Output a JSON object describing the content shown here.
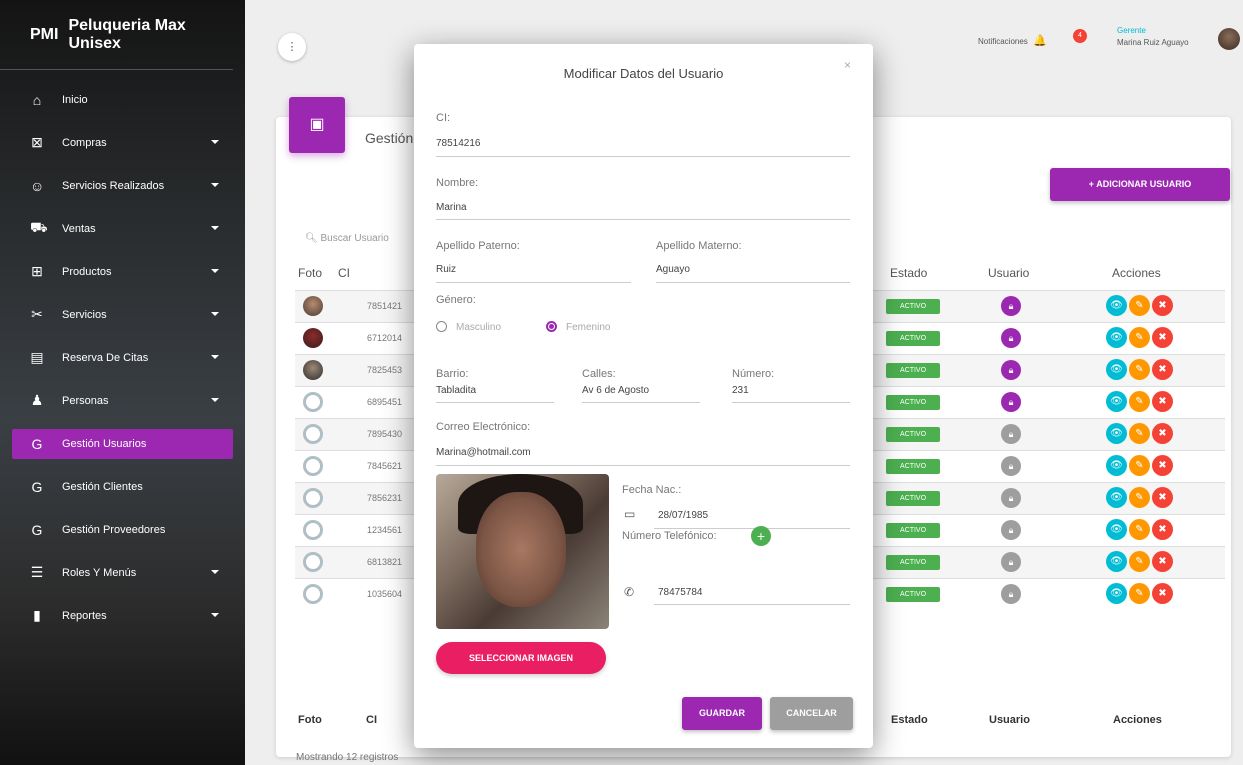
{
  "sidebar": {
    "brand_abbr": "PMI",
    "brand_name": "Peluqueria Max Unisex",
    "items": [
      {
        "label": "Inicio",
        "icon": "home-icon",
        "glyph": "⌂",
        "caret": false
      },
      {
        "label": "Compras",
        "icon": "cart-off-icon",
        "glyph": "⊠",
        "caret": true
      },
      {
        "label": "Servicios Realizados",
        "icon": "face-icon",
        "glyph": "☺",
        "caret": true
      },
      {
        "label": "Ventas",
        "icon": "cart-icon",
        "glyph": "⛟",
        "caret": true
      },
      {
        "label": "Productos",
        "icon": "basket-icon",
        "glyph": "⊞",
        "caret": true
      },
      {
        "label": "Servicios",
        "icon": "scissors-icon",
        "glyph": "✂",
        "caret": true
      },
      {
        "label": "Reserva De Citas",
        "icon": "list-icon",
        "glyph": "▤",
        "caret": true
      },
      {
        "label": "Personas",
        "icon": "person-icon",
        "glyph": "♟",
        "caret": true
      },
      {
        "label": "Gestión Usuarios",
        "icon": "letter-g-icon",
        "glyph": "G",
        "caret": false,
        "active": true
      },
      {
        "label": "Gestión Clientes",
        "icon": "letter-g-icon",
        "glyph": "G",
        "caret": false
      },
      {
        "label": "Gestión Proveedores",
        "icon": "letter-g-icon",
        "glyph": "G",
        "caret": false
      },
      {
        "label": "Roles Y Menús",
        "icon": "menu-icon",
        "glyph": "☰",
        "caret": true
      },
      {
        "label": "Reportes",
        "icon": "report-icon",
        "glyph": "▮",
        "caret": true
      }
    ]
  },
  "topbar": {
    "menu_dots": "⋮",
    "notifications_label": "Notificaciones",
    "notifications_count": "4",
    "user_role": "Gerente",
    "user_name": "Marina Ruiz Aguayo"
  },
  "card": {
    "title": "Gestión de Usuarios",
    "add_button": "+ ADICIONAR USUARIO",
    "search_placeholder": "Buscar Usuario",
    "headers": {
      "foto": "Foto",
      "ci": "CI",
      "estado": "Estado",
      "usuario": "Usuario",
      "acciones": "Acciones"
    },
    "rows": [
      {
        "ci": "7851421",
        "estado": "ACTIVO",
        "user_active": true,
        "photo": "photo"
      },
      {
        "ci": "6712014",
        "estado": "ACTIVO",
        "user_active": true,
        "photo": "photo"
      },
      {
        "ci": "7825453",
        "estado": "ACTIVO",
        "user_active": true,
        "photo": "photo"
      },
      {
        "ci": "6895451",
        "estado": "ACTIVO",
        "user_active": true,
        "photo": "default"
      },
      {
        "ci": "7895430",
        "estado": "ACTIVO",
        "user_active": false,
        "photo": "default"
      },
      {
        "ci": "7845621",
        "estado": "ACTIVO",
        "user_active": false,
        "photo": "default"
      },
      {
        "ci": "7856231",
        "estado": "ACTIVO",
        "user_active": false,
        "photo": "default"
      },
      {
        "ci": "1234561",
        "estado": "ACTIVO",
        "user_active": false,
        "photo": "default"
      },
      {
        "ci": "6813821",
        "estado": "ACTIVO",
        "user_active": false,
        "photo": "default"
      },
      {
        "ci": "1035604",
        "estado": "ACTIVO",
        "user_active": false,
        "photo": "default"
      }
    ],
    "footer": {
      "foto": "Foto",
      "ci": "CI",
      "estado": "Estado",
      "usuario": "Usuario",
      "acciones": "Acciones"
    },
    "mostrando": "Mostrando 12 registros"
  },
  "modal": {
    "title": "Modificar Datos del Usuario",
    "close": "×",
    "ci_label": "CI:",
    "ci_value": "78514216",
    "nombre_label": "Nombre:",
    "nombre_value": "Marina",
    "ap_paterno_label": "Apellido Paterno:",
    "ap_paterno_value": "Ruiz",
    "ap_materno_label": "Apellido Materno:",
    "ap_materno_value": "Aguayo",
    "genero_label": "Género:",
    "genero_masculino": "Masculino",
    "genero_femenino": "Femenino",
    "genero_selected": "Femenino",
    "barrio_label": "Barrio:",
    "barrio_value": "Tabladita",
    "calles_label": "Calles:",
    "calles_value": "Av 6 de Agosto",
    "numero_label": "Número:",
    "numero_value": "231",
    "correo_label": "Correo Electrónico:",
    "correo_value": "Marina@hotmail.com",
    "fecha_label": "Fecha Nac.:",
    "fecha_value": "28/07/1985",
    "telefono_label": "Número Telefónico:",
    "telefono_value": "78475784",
    "select_image": "SELECCIONAR IMAGEN",
    "guardar": "GUARDAR",
    "cancelar": "CANCELAR"
  },
  "colors": {
    "primary": "#9c27b0",
    "success": "#4caf50",
    "info": "#00bcd4",
    "warning": "#ff9800",
    "danger": "#f44336",
    "pink": "#e91e63"
  }
}
